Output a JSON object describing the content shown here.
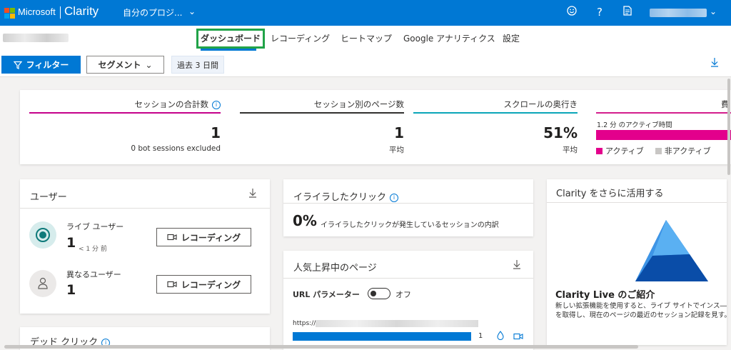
{
  "header": {
    "brand": "Microsoft",
    "product": "Clarity",
    "project": "自分のプロジ...",
    "icons": [
      "smiley-icon",
      "help-icon",
      "document-icon"
    ]
  },
  "tabs": [
    {
      "label": "ダッシュボード",
      "active": true
    },
    {
      "label": "レコーディング",
      "active": false
    },
    {
      "label": "ヒートマップ",
      "active": false
    },
    {
      "label": "Google アナリティクス",
      "active": false
    },
    {
      "label": "設定",
      "active": false
    }
  ],
  "filters": {
    "filter_label": "フィルター",
    "segment_label": "セグメント",
    "date_range": "過去 3 日間"
  },
  "summary": {
    "sessions": {
      "title": "セッションの合計数",
      "value": "1",
      "sub": "0 bot sessions excluded",
      "color": "#c4008a"
    },
    "pages_per_session": {
      "title": "セッション別のページ数",
      "value": "1",
      "sub": "平均",
      "color": "#323130"
    },
    "scroll_depth": {
      "title": "スクロールの奥行き",
      "value": "51%",
      "sub": "平均",
      "color": "#0aa6b8"
    },
    "active_time": {
      "title": "費",
      "caption": "1.2 分 のアクティブ時間",
      "active_label": "アクティブ",
      "inactive_label": "非アクティブ",
      "active_fraction": 1.0,
      "active_color": "#e3008c",
      "inactive_color": "#c8c6c4"
    }
  },
  "users_card": {
    "title": "ユーザー",
    "live_label": "ライブ ユーザー",
    "live_count": "1",
    "live_ago": "< 1 分 前",
    "distinct_label": "異なるユーザー",
    "distinct_count": "1",
    "recording_label": "レコーディング"
  },
  "dead_clicks_card": {
    "title": "デッド クリック"
  },
  "rage_clicks_card": {
    "title": "イライラしたクリック",
    "value": "0%",
    "description": "イライラしたクリックが発生しているセッションの内訳"
  },
  "trending_card": {
    "title": "人気上昇中のページ",
    "url_param_label": "URL パラメーター",
    "toggle_state": "オフ",
    "url_prefix": "https://",
    "rows": [
      {
        "count": "1",
        "fraction": 1.0
      }
    ]
  },
  "promo_card": {
    "title": "Clarity をさらに活用する",
    "headline": "Clarity Live のご紹介",
    "body": "新しい拡張機能を使用すると、ライブ サイトでインス―プを取得し、現在のページの最近のセッション記録を見す。"
  }
}
